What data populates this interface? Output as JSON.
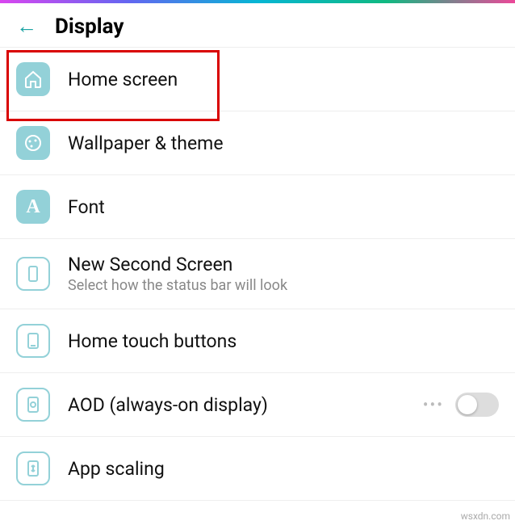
{
  "header": {
    "title": "Display"
  },
  "rows": {
    "home_screen": {
      "label": "Home screen"
    },
    "wallpaper": {
      "label": "Wallpaper & theme"
    },
    "font": {
      "label": "Font"
    },
    "second_screen": {
      "label": "New Second Screen",
      "sub": "Select how the status bar will look"
    },
    "touch_buttons": {
      "label": "Home touch buttons"
    },
    "aod": {
      "label": "AOD (always-on display)",
      "toggle": false
    },
    "app_scaling": {
      "label": "App scaling"
    }
  },
  "watermark": "wsxdn.com"
}
